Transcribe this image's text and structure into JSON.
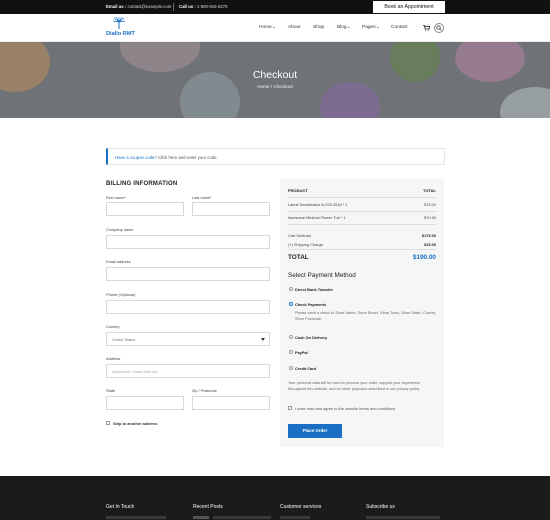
{
  "topbar": {
    "email_label": "Email us :",
    "email": "contact@example.com",
    "call_label": "Call us :",
    "phone": "1-800-915-6270",
    "book_button": "Book an Appointment"
  },
  "brand": {
    "name": "Diallo RMT",
    "logo_icon": "tree-logo-icon"
  },
  "nav": [
    {
      "label": "Home",
      "has_dropdown": true
    },
    {
      "label": "About",
      "has_dropdown": false
    },
    {
      "label": "Shop",
      "has_dropdown": false
    },
    {
      "label": "Blog",
      "has_dropdown": true
    },
    {
      "label": "Pages",
      "has_dropdown": true
    },
    {
      "label": "Contact",
      "has_dropdown": false
    }
  ],
  "nav_labels": {
    "home": "Home⌄",
    "about": "About",
    "shop": "Shop",
    "blog": "Blog⌄",
    "pages": "Pages⌄",
    "contact": "Contact"
  },
  "nav_icons": {
    "cart": "cart-icon",
    "search": "search-icon"
  },
  "hero": {
    "title": "Checkout",
    "breadcrumb_home": "Home",
    "breadcrumb_sep": "/",
    "breadcrumb_current": "Checkout"
  },
  "coupon": {
    "question": "Have a coupon code?",
    "link_text": "Click here and enter your code."
  },
  "billing": {
    "title": "BILLING INFORMATION",
    "first_name_label": "First name*",
    "last_name_label": "Last name*",
    "company_label": "Company name",
    "email_label": "Email address",
    "phone_label": "Phone (Optional)",
    "country_label": "Country",
    "country_value": "United States",
    "address_label": "Address",
    "address_placeholder": "Apartment, Street Address",
    "state_label": "State",
    "zip_label": "Zip / Postcode",
    "ship_label": "Ship to another address"
  },
  "order": {
    "col_product": "PRODUCT",
    "col_total": "TOTAL",
    "items": [
      {
        "name": "Latest Smartwatch N-200 2018 * 1",
        "price": "$75.00"
      },
      {
        "name": "Awesome Minimal Flower Tub * 1",
        "price": "$70.50"
      }
    ],
    "subtotal_label": "Cart Subtotal",
    "subtotal": "$175.00",
    "shipping_label": "(+) Shipping Charge",
    "shipping": "$15.00",
    "total_label": "TOTAL",
    "total": "$190.00"
  },
  "payment": {
    "title": "Select Payment Method",
    "methods": [
      {
        "label": "Direct Bank Transfer",
        "selected": false
      },
      {
        "label": "Check Payments",
        "selected": true
      },
      {
        "label": "Cash On Delivery",
        "selected": false
      },
      {
        "label": "PayPal",
        "selected": false
      },
      {
        "label": "Credit Card",
        "selected": false
      }
    ],
    "check_description": "Please send a check to Store Name, Store Street, Store Town, Store State / County, Store Postcode.",
    "privacy_note": "Your personal data will be used to process your order, support your experience throughout this website, and for other purposes described in our privacy policy.",
    "terms_label": "I have read and agree to the website terms and conditions",
    "place_order": "Place Order"
  },
  "footer": {
    "columns": [
      "Get In Touch",
      "Recent Posts",
      "Customer services",
      "Subscribe us"
    ]
  },
  "colors": {
    "accent": "#1a6fc4",
    "topbar": "#111111",
    "footer": "#1b1b1b",
    "order_panel": "#f5f6f8"
  }
}
